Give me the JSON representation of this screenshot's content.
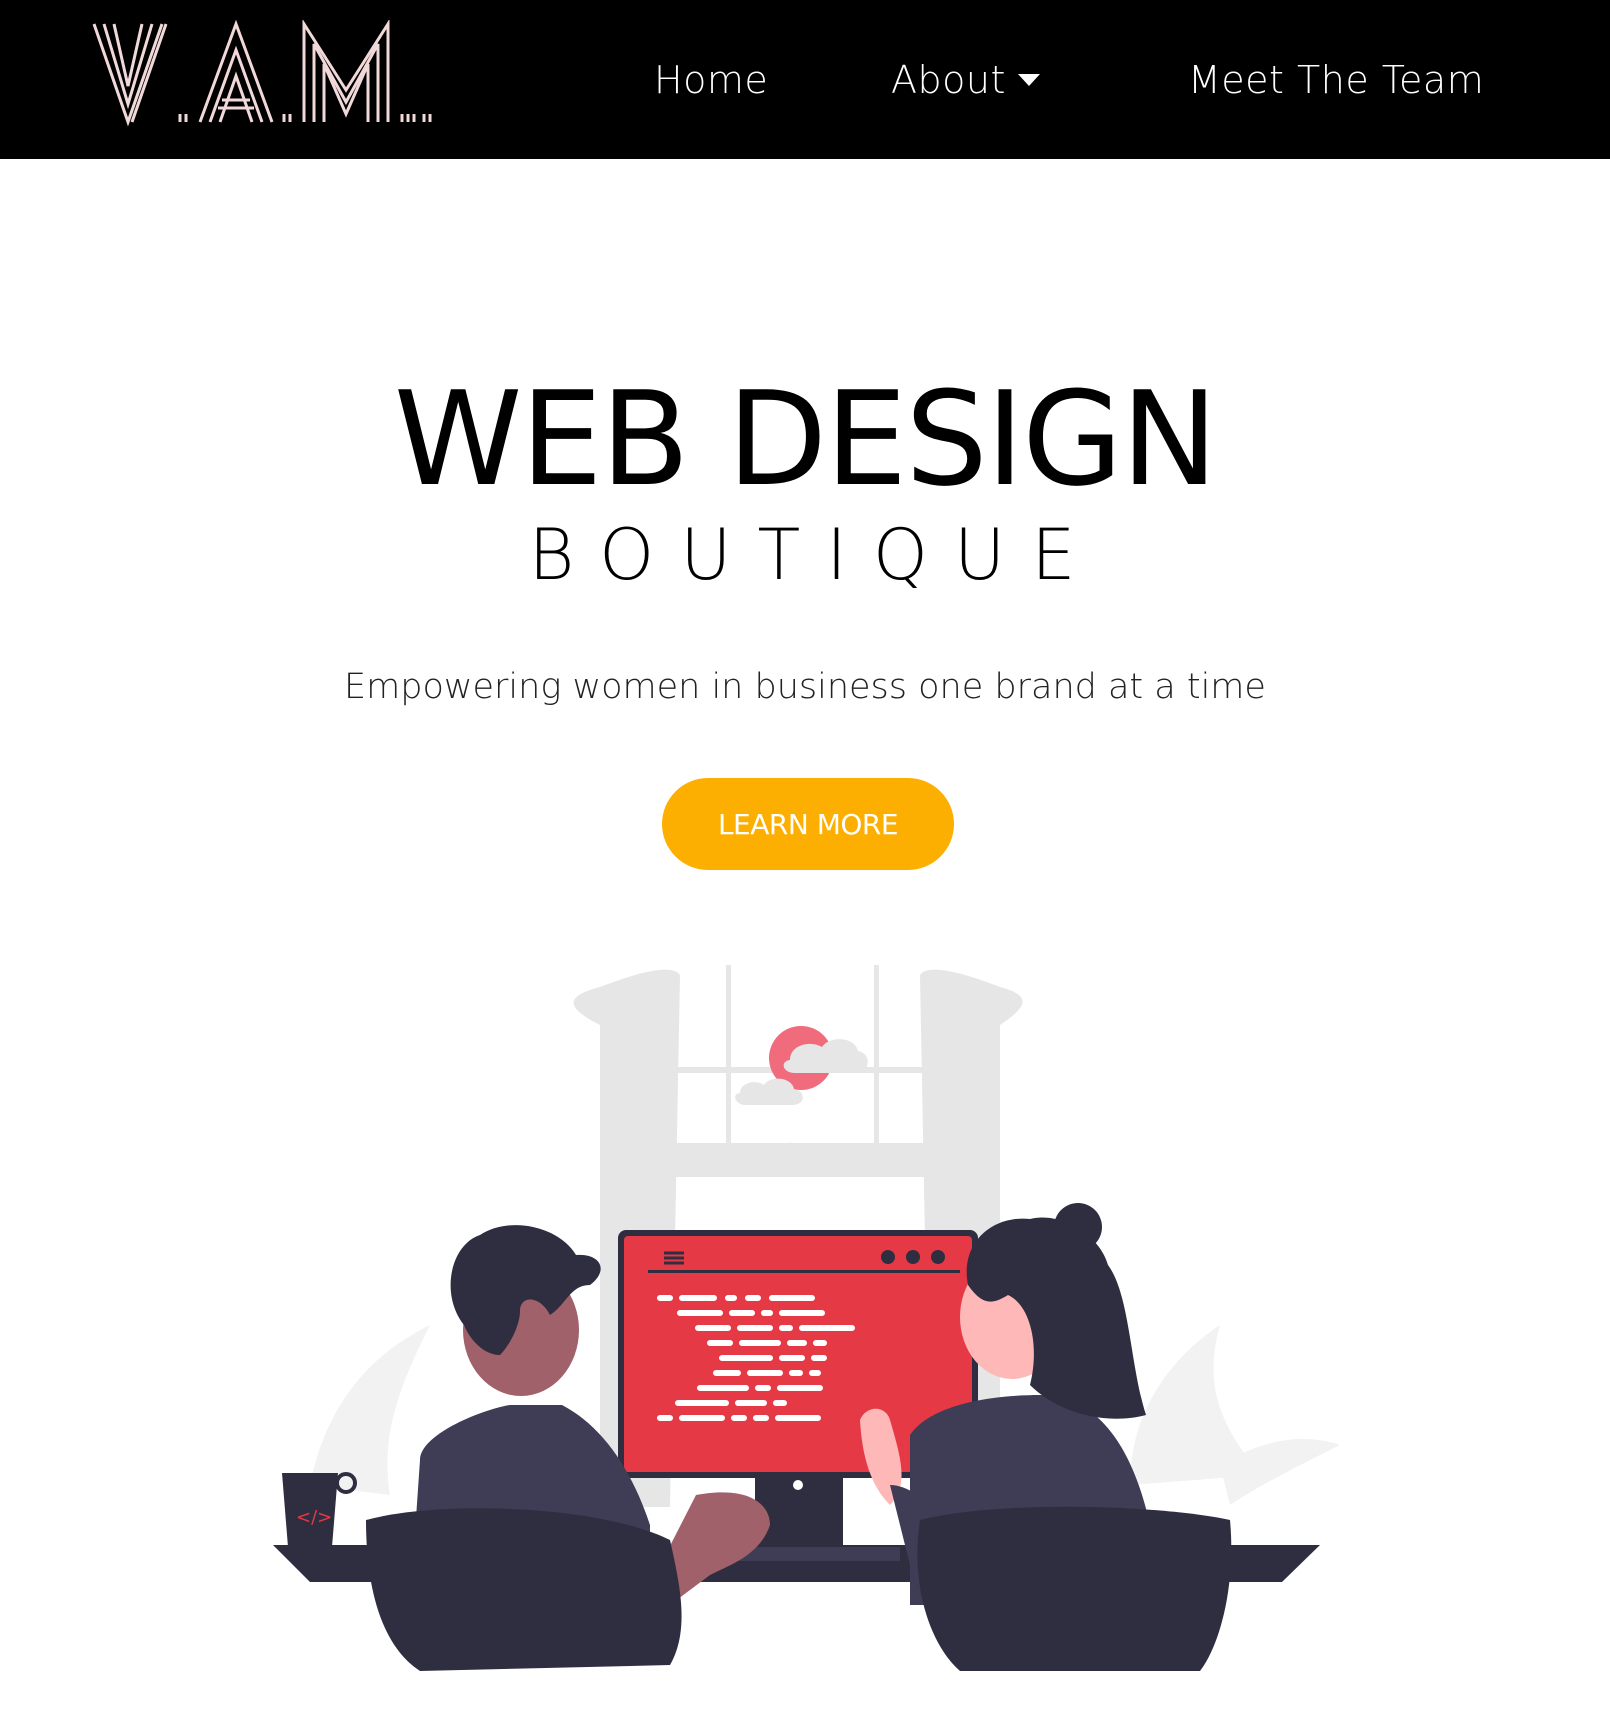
{
  "header": {
    "logo_text": "V.A.M.",
    "nav": {
      "home": "Home",
      "about": "About",
      "team": "Meet The Team"
    }
  },
  "hero": {
    "title": "WEB DESIGN",
    "subtitle": "BOUTIQUE",
    "tagline": "Empowering women in business one brand at a time",
    "cta_label": "LEARN MORE"
  },
  "illustration": {
    "name": "two-people-coding-illustration",
    "code_icon": "</>"
  },
  "colors": {
    "header_bg": "#000000",
    "accent": "#fcaf00",
    "screen": "#e63946",
    "figure_dark": "#2f2e41",
    "skin_pink": "#ffb8b8",
    "skin_brown": "#a0616a"
  }
}
